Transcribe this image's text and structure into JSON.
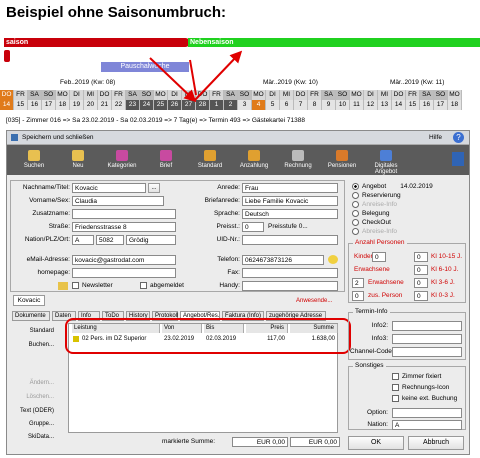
{
  "heading": "Beispiel ohne Saisonumbruch:",
  "seasons": {
    "left": "saison",
    "right": "Nebensaison",
    "special": "Pauschalwoche"
  },
  "calendar": {
    "weeks": [
      "Feb..2019 (Kw: 08)",
      "Mär..2019 (Kw: 10)",
      "Mär..2019 (Kw: 11)"
    ],
    "days": [
      "DO",
      "FR",
      "SA",
      "SO",
      "MO",
      "DI",
      "MI",
      "DO",
      "FR",
      "SA",
      "SO",
      "MO",
      "DI",
      "MI",
      "DO",
      "FR",
      "SA",
      "SO",
      "MO",
      "DI",
      "MI",
      "DO",
      "FR",
      "SA",
      "SO",
      "MO",
      "DI",
      "MI",
      "DO",
      "FR",
      "SA",
      "SO",
      "MO"
    ],
    "dates": [
      "14",
      "15",
      "16",
      "17",
      "18",
      "19",
      "20",
      "21",
      "22",
      "23",
      "24",
      "25",
      "26",
      "27",
      "28",
      "1",
      "2",
      "3",
      "4",
      "5",
      "6",
      "7",
      "8",
      "9",
      "10",
      "11",
      "12",
      "13",
      "14",
      "15",
      "16",
      "17",
      "18"
    ]
  },
  "status_line": "[035] - Zimmer 016 => Sa 23.02.2019 - Sa 02.03.2019 => 7 Tag(e) => Termin 493 => Gästekartei 71388",
  "window": {
    "title": "Speichern und schließen",
    "help": "Hilfe"
  },
  "toolbar": [
    {
      "label": "Suchen",
      "icon": "search-icon"
    },
    {
      "label": "Neu",
      "icon": "new-icon"
    },
    {
      "label": "Kategorien",
      "icon": "categories-icon"
    },
    {
      "label": "Brief",
      "icon": "letter-icon"
    },
    {
      "label": "Standard",
      "icon": "standard-icon"
    },
    {
      "label": "Anzahlung",
      "icon": "deposit-icon"
    },
    {
      "label": "Rechnung",
      "icon": "invoice-icon"
    },
    {
      "label": "Pensionen",
      "icon": "pension-icon"
    },
    {
      "label": "Digitales Angebot",
      "icon": "digital-offer-icon"
    }
  ],
  "guest": {
    "name_label": "Nachname/Titel:",
    "name": "Kovacic",
    "first_label": "Vorname/Sex:",
    "first": "Claudia",
    "extra_label": "Zusatzname:",
    "extra": "",
    "street_label": "Straße:",
    "street": "Friedensstrasse 8",
    "nation_label": "Nation/PLZ/Ort:",
    "nation": "A",
    "zip": "5082",
    "city": "Grödig",
    "email_label": "eMail-Adresse:",
    "email": "kovacic@gastrodat.com",
    "homepage_label": "homepage:",
    "homepage": "",
    "newsletter": "Newsletter",
    "unsubscribed": "abgemeldet"
  },
  "contact": {
    "salutation_label": "Anrede:",
    "salutation": "Frau",
    "letter_label": "Briefanrede:",
    "letter": "Liebe Familie Kovacic",
    "language_label": "Sprache:",
    "language": "Deutsch",
    "price_label": "Preisst.:",
    "price": "0",
    "price_level": "Preisstufe 0...",
    "uid_label": "UID-Nr.:",
    "uid": "",
    "phone_label": "Telefon:",
    "phone": "0624673873126",
    "fax_label": "Fax:",
    "fax": "",
    "mobile_label": "Handy:",
    "mobile": ""
  },
  "status_options": [
    {
      "label": "Angebot",
      "date": "14.02.2019",
      "on": true
    },
    {
      "label": "Reservierung",
      "on": false
    },
    {
      "label": "Anreise-Info",
      "on": false,
      "dim": true
    },
    {
      "label": "Belegung",
      "on": false
    },
    {
      "label": "CheckOut",
      "on": false
    },
    {
      "label": "Abreise-Info",
      "on": false,
      "dim": true
    }
  ],
  "persons": {
    "title": "Anzahl Personen",
    "kinder_label": "Kinder",
    "adults_label": "Erwachsene",
    "adults2_label": "Erwachsene",
    "extra_label": "zus. Person",
    "kinder": "0",
    "adults": "0",
    "adults2": "2",
    "extra": "0",
    "kat": [
      {
        "label": "Kl 10-15 J.",
        "value": "0"
      },
      {
        "label": "Kl 6-10 J.",
        "value": "0"
      },
      {
        "label": "Kl 3-6 J.",
        "value": "0"
      },
      {
        "label": "Kl 0-3 J.",
        "value": "0"
      }
    ]
  },
  "name_tab": "Kovacic",
  "anwesende": "Anwesende...",
  "tabs": [
    "Dokumente",
    "Daten",
    "Info",
    "ToDo",
    "History",
    "Protokoll",
    "Angebot/Res.",
    "Faktura (Info)",
    "zugehörige Adresse"
  ],
  "side_buttons": [
    "Standard",
    "Buchen...",
    "Ändern...",
    "Löschen...",
    "Text (ODER)",
    "Gruppe...",
    "SkiData..."
  ],
  "table": {
    "headers": [
      "Leistung",
      "Von",
      "Bis",
      "Preis",
      "Summe"
    ],
    "rows": [
      [
        "02  Pers. im DZ Superior",
        "23.02.2019",
        "02.03.2019",
        "117,00",
        "1.638,00"
      ]
    ]
  },
  "footer": {
    "label": "markierte Summe:",
    "value": "EUR 0,00",
    "value2": "EUR 0,00"
  },
  "termin": {
    "title": "Termin-Info",
    "info2": "Info2:",
    "info3": "Info3:",
    "channel": "Channel-Code:"
  },
  "sonstiges": {
    "title": "Sonstiges",
    "fixed": "Zimmer fixiert",
    "invoice": "Rechnungs-Icon",
    "ext": "keine ext. Buchung",
    "option_label": "Option:",
    "option": "",
    "nation_label": "Nation:",
    "nation": "A"
  },
  "ok": "OK",
  "cancel": "Abbruch"
}
